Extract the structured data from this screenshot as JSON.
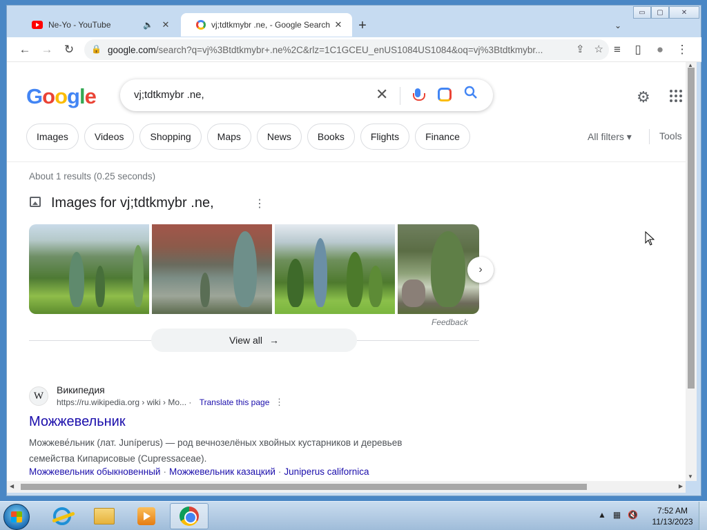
{
  "window": {
    "caption_min": "▭",
    "caption_max": "▢",
    "caption_close": "✕"
  },
  "tabs": [
    {
      "title": "Ne-Yo - YouTube",
      "icon": "youtube-icon",
      "audio": "🔈"
    },
    {
      "title": "vj;tdtkmybr .ne, - Google Search",
      "icon": "google-icon"
    }
  ],
  "tab_new": "+",
  "tab_search": "⌄",
  "toolbar": {
    "back": "←",
    "forward": "→",
    "reload": "↻",
    "lock": "🔒",
    "url_host": "google.com",
    "url_path": "/search?q=vj%3Btdtkmybr+.ne%2C&rlz=1C1GCEU_enUS1084US1084&oq=vj%3Btdtkmybr...",
    "share": "⇪",
    "star": "☆",
    "media": "≡",
    "sidepanel": "▯",
    "profile": "●",
    "menu": "⋮"
  },
  "google": {
    "logo": [
      "G",
      "o",
      "o",
      "g",
      "l",
      "e"
    ],
    "query": "vj;tdtkmybr .ne,",
    "clear": "✕",
    "search_glyph": "⚲",
    "settings_glyph": "⚙"
  },
  "chips": [
    "Images",
    "Videos",
    "Shopping",
    "Maps",
    "News",
    "Books",
    "Flights",
    "Finance"
  ],
  "all_filters": "All filters ▾",
  "tools": "Tools",
  "results_stats": "About 1 results (0.25 seconds)",
  "images_section": {
    "heading": "Images for vj;tdtkmybr .ne,",
    "kebab": "⋮",
    "next": "›",
    "feedback": "Feedback",
    "view_all": "View all",
    "view_all_arrow": "→"
  },
  "result": {
    "favicon": "W",
    "site_name": "Википедия",
    "url": "https://ru.wikipedia.org › wiki › Mo...",
    "translate": "Translate this page",
    "kebab": "⋮",
    "title": "Можжевельник",
    "snippet": "Можжеве́льник (лат. Juníperus) — род вечнозелёных хвойных кустарников и деревьев семейства Кипарисовые (Cupressaceae).",
    "links": [
      "Можжевельник обыкновенный",
      "Можжевельник казацкий",
      "Juniperus californica"
    ],
    "link_sep": "·"
  },
  "taskbar": {
    "apps": [
      "internet-explorer",
      "file-explorer",
      "media-player",
      "chrome"
    ],
    "tray_up": "▲",
    "time": "7:52 AM",
    "date": "11/13/2023"
  }
}
